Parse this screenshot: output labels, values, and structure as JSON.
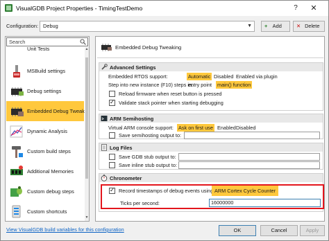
{
  "window": {
    "title": "VisualGDB Project Properties - TimingTestDemo",
    "help": "?",
    "close": "✕"
  },
  "config": {
    "label": "Configuration:",
    "value": "Debug",
    "add_label": "Add",
    "delete_label": "Delete"
  },
  "sidebar": {
    "search_placeholder": "Search",
    "items": [
      {
        "label": "Unit Tests",
        "icon": "unit-tests-icon"
      },
      {
        "label": "MSBuild settings",
        "icon": "msbuild-icon"
      },
      {
        "label": "Debug settings",
        "icon": "chip-icon"
      },
      {
        "label": "Embedded Debug Tweaking",
        "icon": "chip-icon",
        "selected": true
      },
      {
        "label": "Dynamic Analysis",
        "icon": "chart-icon"
      },
      {
        "label": "Custom build steps",
        "icon": "hammer-icon"
      },
      {
        "label": "Additional Memories",
        "icon": "memory-icon"
      },
      {
        "label": "Custom debug steps",
        "icon": "bug-icon"
      },
      {
        "label": "Custom shortcuts",
        "icon": "shortcut-icon"
      }
    ]
  },
  "panel": {
    "title": "Embedded Debug Tweaking",
    "advanced": {
      "title": "Advanced Settings",
      "rtos_label": "Embedded RTOS support:",
      "rtos_options": [
        "Automatic",
        "Disabled",
        "Enabled via plugin"
      ],
      "step_label": "Step into new instance (F10) steps in:",
      "step_options": [
        "entry point",
        "main() function"
      ],
      "reload_label": "Reload firmware when reset button is pressed",
      "validate_label": "Validate stack pointer when starting debugging"
    },
    "semihosting": {
      "title": "ARM Semihosting",
      "console_label": "Virtual ARM console support:",
      "console_options": [
        "Ask on first use",
        "Enabled",
        "Disabled"
      ],
      "save_label": "Save semihosting output to:"
    },
    "logfiles": {
      "title": "Log Files",
      "gdb_label": "Save GDB stub output to:",
      "inline_label": "Save inline stub output to:"
    },
    "chronometer": {
      "title": "Chronometer",
      "record_label": "Record timestamps of debug events using:",
      "counter_value": "ARM Cortex Cycle Counter",
      "ticks_label": "Ticks per second:",
      "ticks_value": "16000000"
    }
  },
  "footer": {
    "link": "View VisualGDB build variables for this configuration",
    "ok": "OK",
    "cancel": "Cancel",
    "apply": "Apply"
  },
  "colors": {
    "selection": "#ffc83d",
    "highlight_border": "#e3151c",
    "link": "#0b62c4"
  }
}
